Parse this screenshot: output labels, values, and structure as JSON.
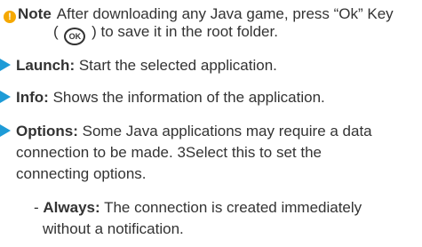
{
  "note": {
    "icon": "note-icon",
    "label": "Note",
    "line1": "After downloading any Java game, press “Ok” Key",
    "line2_pre": "(",
    "ok_key": "OK",
    "line2_post": ") to save it in the root folder."
  },
  "items": [
    {
      "term": "Launch:",
      "text": "Start the selected application."
    },
    {
      "term": "Info:",
      "text": "Shows the information of the application."
    },
    {
      "term": "Options:",
      "text": "Some Java applications may require a data",
      "cont1": "connection to be made. 3Select this to set the",
      "cont2": "connecting options."
    }
  ],
  "sub_item": {
    "dash": "-",
    "term": "Always:",
    "text": "The connection is created immediately",
    "cont": "without a notification."
  },
  "colors": {
    "accent": "#1e9bd7",
    "note_icon": "#f5a800",
    "text": "#333333"
  }
}
